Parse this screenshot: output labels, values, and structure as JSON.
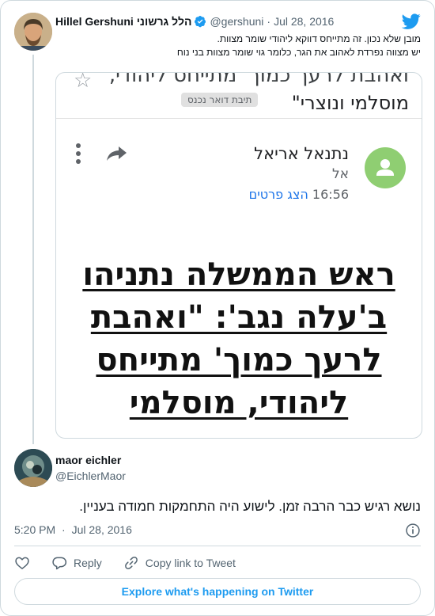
{
  "colors": {
    "accent": "#1d9bf0",
    "text": "#0f1419",
    "muted": "#536471",
    "border": "#cfd9de",
    "gmail_link": "#1a73e8",
    "sender_avatar": "#8fce72"
  },
  "parent_tweet": {
    "author_name": "Hillel Gershuni הלל גרשוני",
    "verified_icon": "verified-badge-icon",
    "handle": "@gershuni",
    "separator": "·",
    "date": "Jul 28, 2016",
    "text_lines": [
      "מובן שלא נכון. זה מתייחס דווקא ליהודי שומר מצוות.",
      "יש מצווה נפרדת לאהוב את הגר, כלומר גוי שומר מצוות בני נוח"
    ],
    "embedded_email": {
      "subject_line_1": "ואהבת לרעך כמוך' מתייחס ליהודי,",
      "subject_line_2": "מוסלמי ונוצרי\"",
      "inbox_label": "תיבת דואר נכנס",
      "sender_name": "נתנאל אריאל",
      "to_label": "אל",
      "time": "16:56",
      "details_link": "הצג פרטים",
      "headline_lines": [
        "ראש הממשלה נתניהו",
        "ב'עלה נגב': \"ואהבת",
        "לרעך כמוך' מתייחס",
        "ליהודי, מוסלמי"
      ]
    }
  },
  "reply_tweet": {
    "author_name": "maor eichler",
    "handle": "@EichlerMaor",
    "text": "נושא רגיש כבר הרבה זמן. לישוע היה התחמקות חמודה בעניין.",
    "time": "5:20 PM",
    "separator": "·",
    "date": "Jul 28, 2016"
  },
  "actions": {
    "like_icon": "heart-icon",
    "reply_label": "Reply",
    "copy_link_label": "Copy link to Tweet"
  },
  "explore_label": "Explore what's happening on Twitter"
}
